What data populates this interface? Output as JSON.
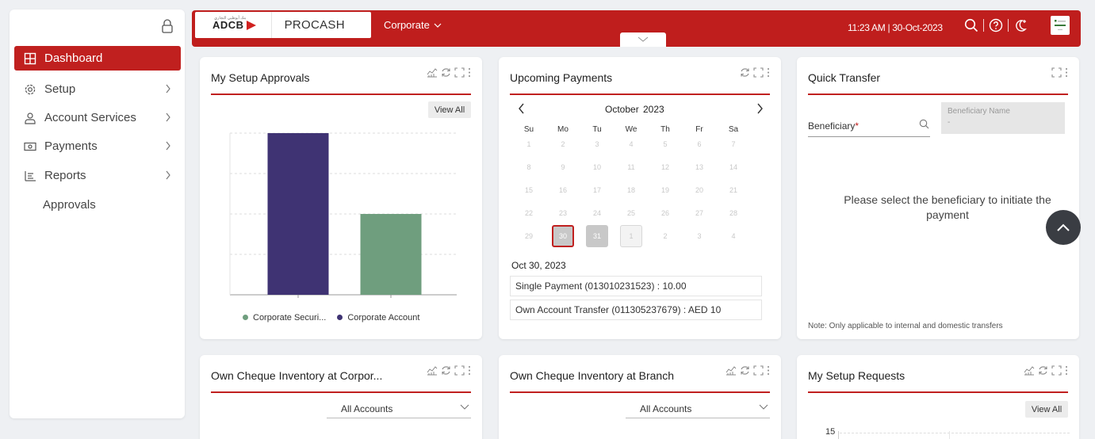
{
  "sidebar": {
    "items": [
      {
        "label": "Dashboard",
        "icon": "grid-icon",
        "active": true
      },
      {
        "label": "Setup",
        "icon": "gear-icon"
      },
      {
        "label": "Account Services",
        "icon": "user-icon"
      },
      {
        "label": "Payments",
        "icon": "money-icon"
      },
      {
        "label": "Reports",
        "icon": "list-icon"
      },
      {
        "label": "Approvals"
      }
    ]
  },
  "header": {
    "bank_logo": "ADCB",
    "bank_logo_arabic": "بنك أبوظبي التجاري",
    "app_name": "PROCASH",
    "entity_select": "Corporate",
    "datetime": "11:23 AM | 30-Oct-2023",
    "brand_color": "#bf1e1d"
  },
  "setup_approvals": {
    "title": "My Setup Approvals",
    "view_all": "View All",
    "chart_data": {
      "type": "bar",
      "categories": [
        "Corporate Account",
        "Corporate Securi..."
      ],
      "values": [
        4,
        2
      ],
      "ylim": [
        0,
        4
      ],
      "colors": [
        "#3f3373",
        "#6f9e7e"
      ],
      "legend": [
        {
          "label": "Corporate Securi...",
          "color": "#6f9e7e"
        },
        {
          "label": "Corporate Account",
          "color": "#3f3373"
        }
      ],
      "legend_position": "bottom",
      "grid": true
    }
  },
  "upcoming_payments": {
    "title": "Upcoming Payments",
    "month": "October",
    "year": "2023",
    "weekdays": [
      "Su",
      "Mo",
      "Tu",
      "We",
      "Th",
      "Fr",
      "Sa"
    ],
    "weeks": [
      [
        "1",
        "2",
        "3",
        "4",
        "5",
        "6",
        "7"
      ],
      [
        "8",
        "9",
        "10",
        "11",
        "12",
        "13",
        "14"
      ],
      [
        "15",
        "16",
        "17",
        "18",
        "19",
        "20",
        "21"
      ],
      [
        "22",
        "23",
        "24",
        "25",
        "26",
        "27",
        "28"
      ],
      [
        "29",
        "30",
        "31",
        "1",
        "2",
        "3",
        "4"
      ]
    ],
    "selected_date": "Oct 30, 2023",
    "payments": [
      "Single Payment (013010231523) : 10.00",
      "Own Account Transfer (011305237679) : AED 10"
    ]
  },
  "quick_transfer": {
    "title": "Quick Transfer",
    "beneficiary_label": "Beneficiary",
    "required_mark": "*",
    "beneficiary_name_label": "Beneficiary Name",
    "beneficiary_name_value": "-",
    "message": "Please select the beneficiary to initiate the payment",
    "note": "Note:  Only applicable to internal and domestic transfers"
  },
  "cheque_corporate": {
    "title": "Own Cheque Inventory at Corpor...",
    "select": "All Accounts"
  },
  "cheque_branch": {
    "title": "Own Cheque Inventory at Branch",
    "select": "All Accounts"
  },
  "setup_requests": {
    "title": "My Setup Requests",
    "view_all": "View All",
    "chart_data": {
      "type": "bar",
      "categories": [],
      "values": [],
      "yticks": [
        "15"
      ]
    }
  }
}
